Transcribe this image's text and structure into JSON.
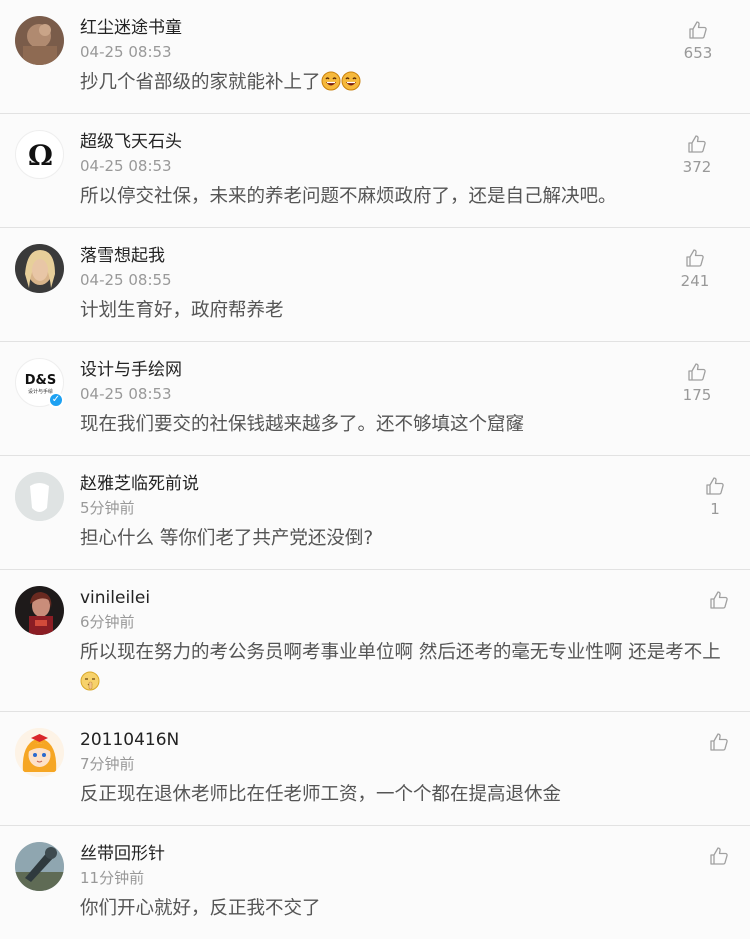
{
  "comments": [
    {
      "username": "红尘迷途书童",
      "time": "04-25 08:53",
      "text": "抄几个省部级的家就能补上了",
      "likes": "653"
    },
    {
      "username": "超级飞天石头",
      "time": "04-25 08:53",
      "text": "所以停交社保，未来的养老问题不麻烦政府了，还是自己解决吧。",
      "likes": "372"
    },
    {
      "username": "落雪想起我",
      "time": "04-25 08:55",
      "text": "计划生育好，政府帮养老",
      "likes": "241"
    },
    {
      "username": "设计与手绘网",
      "time": "04-25 08:53",
      "text": "现在我们要交的社保钱越来越多了。还不够填这个窟窿",
      "likes": "175",
      "avatar_text": "D&S",
      "avatar_subtext": "设计与手绘"
    },
    {
      "username": "赵雅芝临死前说",
      "time": "5分钟前",
      "text": "担心什么 等你们老了共产党还没倒?",
      "likes": "1"
    },
    {
      "username": "vinileilei",
      "time": "6分钟前",
      "text": "所以现在努力的考公务员啊考事业单位啊 然后还考的毫无专业性啊 还是考不上",
      "likes": ""
    },
    {
      "username": "20110416N",
      "time": "7分钟前",
      "text": "反正现在退休老师比在任老师工资，一个个都在提高退休金",
      "likes": ""
    },
    {
      "username": "丝带回形针",
      "time": "11分钟前",
      "text": "你们开心就好，反正我不交了",
      "likes": ""
    }
  ]
}
